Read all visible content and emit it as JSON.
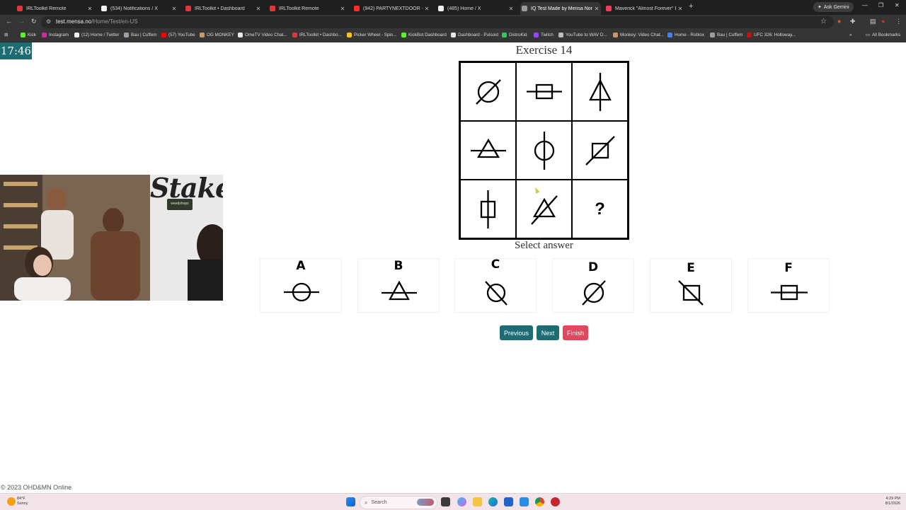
{
  "browser": {
    "tabs": [
      {
        "label": "IRLToolkit Remote",
        "color": "#e0353a"
      },
      {
        "label": "(534) Notifications / X",
        "color": "#f0f0f0"
      },
      {
        "label": "IRLToolkit • Dashboard",
        "color": "#e0353a"
      },
      {
        "label": "IRLToolkit Remote",
        "color": "#e0353a"
      },
      {
        "label": "(942) PARTYNEXTDOOR - Only",
        "color": "#ff2a2a"
      },
      {
        "label": "(485) Home / X",
        "color": "#f0f0f0"
      },
      {
        "label": "IQ Test Made by Mensa Norwa",
        "color": "#9a9a9a"
      },
      {
        "label": "Maverick \"Almost Forever\" EP",
        "color": "#f23b5a"
      }
    ],
    "active_tab_index": 6,
    "new_tab_symbol": "+",
    "gemini_label": "Ask Gemini",
    "window_controls": [
      "—",
      "❐",
      "✕"
    ],
    "url_host": "test.mensa.no",
    "url_path": "/Home/Test/en-US",
    "bookmarks": [
      {
        "label": "Kick",
        "color": "#53fc18"
      },
      {
        "label": "Instagram",
        "color": "#d6249f"
      },
      {
        "label": "(12) Home / Twitter",
        "color": "#f0f0f0"
      },
      {
        "label": "Bau | Cuffem",
        "color": "#9aa0a6"
      },
      {
        "label": "(57) YouTube",
        "color": "#ff0000"
      },
      {
        "label": "OG MONKEY",
        "color": "#c49a6c"
      },
      {
        "label": "OmeTV Video Chat...",
        "color": "#e8e8e8"
      },
      {
        "label": "IRLToolkit • Dashbo...",
        "color": "#e0353a"
      },
      {
        "label": "Picker Wheel - Spin...",
        "color": "#f5c518"
      },
      {
        "label": "KickBot Dashboard",
        "color": "#53fc18"
      },
      {
        "label": "Dashboard - Pulsoid",
        "color": "#e8e8e8"
      },
      {
        "label": "DistroKid",
        "color": "#34c759"
      },
      {
        "label": "Twitch",
        "color": "#9146ff"
      },
      {
        "label": "YouTube to WAV D...",
        "color": "#bbbbbb"
      },
      {
        "label": "Monkey: Video Chat...",
        "color": "#c49a6c"
      },
      {
        "label": "Home - Roblox",
        "color": "#3b82f6"
      },
      {
        "label": "Bau | Cuffem",
        "color": "#9aa0a6"
      },
      {
        "label": "UFC 326: Holloway...",
        "color": "#d20a0a"
      }
    ],
    "all_bookmarks_label": "All Bookmarks"
  },
  "page": {
    "timer": "17:46",
    "exercise_title": "Exercise 14",
    "question_mark": "?",
    "select_label": "Select answer",
    "options": [
      "A",
      "B",
      "C",
      "D",
      "E",
      "F"
    ],
    "buttons": {
      "previous": "Previous",
      "next": "Next",
      "finish": "Finish"
    },
    "colors": {
      "teal": "#1d6b73",
      "finish": "#e0485f"
    },
    "footer": "© 2023 OHD&MN Online"
  },
  "webcam": {
    "overlay_text": "Stake",
    "sign_text": "weedshops"
  },
  "taskbar": {
    "weather_temp": "84°F",
    "weather_cond": "Sunny",
    "search_placeholder": "Search",
    "time": "4:29 PM",
    "date": "8/1/2026"
  }
}
